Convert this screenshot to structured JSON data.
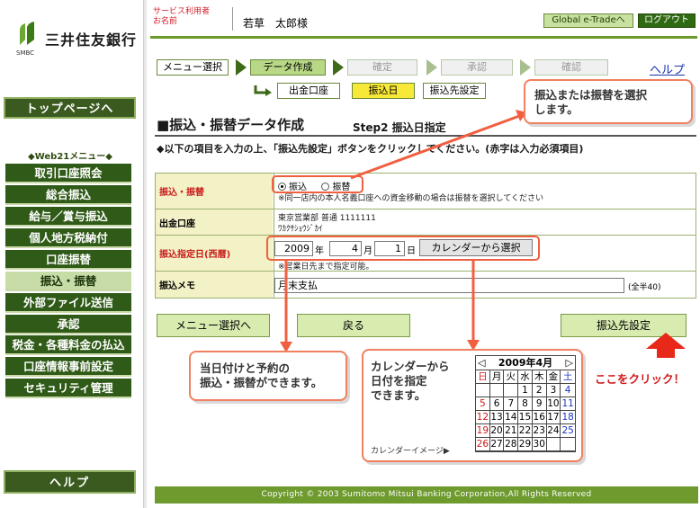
{
  "brand": {
    "name": "三井住友銀行",
    "sub": "SMBC"
  },
  "sidebar": {
    "top_button": "トップページへ",
    "menu_title": "◆Web21メニュー◆",
    "items": [
      {
        "label": "取引口座照会"
      },
      {
        "label": "総合振込"
      },
      {
        "label": "給与／賞与振込"
      },
      {
        "label": "個人地方税納付"
      },
      {
        "label": "口座振替"
      },
      {
        "label": "振込・振替",
        "active": true
      },
      {
        "label": "外部ファイル送信"
      },
      {
        "label": "承認"
      },
      {
        "label": "税金・各種料金の払込"
      },
      {
        "label": "口座情報事前設定"
      },
      {
        "label": "セキュリティ管理"
      }
    ],
    "help_button": "ヘルプ"
  },
  "header": {
    "user_label_1": "サービス利用者",
    "user_label_2": "お名前",
    "user_name": "若草　太郎様",
    "global_button": "Global e-Tradeへ",
    "logout_button": "ログアウト"
  },
  "steps": [
    {
      "label": "メニュー選択",
      "state": "done"
    },
    {
      "label": "データ作成",
      "state": "current"
    },
    {
      "label": "確定",
      "state": "todo"
    },
    {
      "label": "承認",
      "state": "todo"
    },
    {
      "label": "確認",
      "state": "todo"
    }
  ],
  "help_link": "ヘルプ",
  "subtabs": [
    {
      "label": "出金口座"
    },
    {
      "label": "振込日",
      "active": true
    },
    {
      "label": "振込先設定"
    }
  ],
  "page": {
    "title": "■振込・振替データ作成",
    "step": "Step2 振込日指定",
    "instruction": "◆以下の項目を入力の上、「振込先設定」ボタンをクリックしてください。(赤字は入力必須項目)"
  },
  "form": {
    "type_label": "振込・振替",
    "type_opt1": "振込",
    "type_opt2": "振替",
    "type_note": "※同一店内の本人名義口座への資金移動の場合は振替を選択してください",
    "account_label": "出金口座",
    "account_line1": "東京営業部 普通 1111111",
    "account_line2": "ﾜｶｸｻｼｮｳｼﾞｶｲ",
    "date_label": "振込指定日(西暦)",
    "year": "2009",
    "year_unit": "年",
    "month": "4",
    "month_unit": "月",
    "day": "1",
    "day_unit": "日",
    "calendar_button": "カレンダーから選択",
    "date_note": "※営業日先まで指定可能。",
    "memo_label": "振込メモ",
    "memo_value": "月末支払",
    "memo_limit": "(全半40)"
  },
  "buttons": {
    "menu_back": "メニュー選択へ",
    "back": "戻る",
    "next": "振込先設定"
  },
  "callouts": {
    "select": "振込または振替を選択\nします。",
    "date": "当日付けと予約の\n振込・振替ができます。",
    "calendar": "カレンダーから\n日付を指定\nできます。",
    "calendar_image": "カレンダーイメージ▶",
    "click_here": "ここをクリック！"
  },
  "calendar": {
    "prev": "◁",
    "title": "2009年4月",
    "next": "▷",
    "weekdays": [
      "日",
      "月",
      "火",
      "水",
      "木",
      "金",
      "土"
    ],
    "weeks": [
      [
        "",
        "",
        "",
        "1",
        "2",
        "3",
        "4"
      ],
      [
        "5",
        "6",
        "7",
        "8",
        "9",
        "10",
        "11"
      ],
      [
        "12",
        "13",
        "14",
        "15",
        "16",
        "17",
        "18"
      ],
      [
        "19",
        "20",
        "21",
        "22",
        "23",
        "24",
        "25"
      ],
      [
        "26",
        "27",
        "28",
        "29",
        "30",
        "",
        ""
      ]
    ]
  },
  "footer": "Copyright © 2003 Sumitomo Mitsui Banking Corporation,All Rights Reserved",
  "colors": {
    "brand_green": "#2f5a17",
    "accent_orange": "#f08060",
    "highlight_yellow": "#f8e838",
    "alert_red": "#d01818"
  }
}
